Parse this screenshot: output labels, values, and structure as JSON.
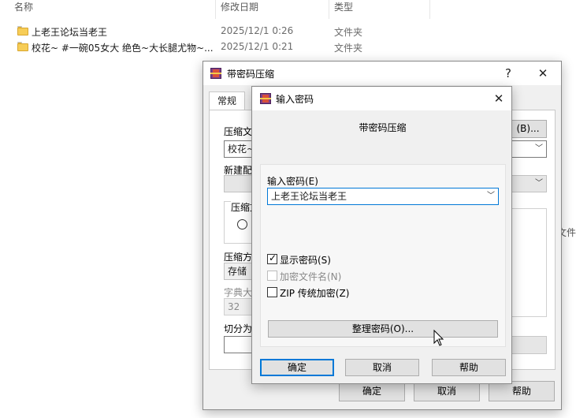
{
  "explorer": {
    "columns": {
      "name": "名称",
      "date": "修改日期",
      "type": "类型"
    },
    "rows": [
      {
        "name": "上老王论坛当老王",
        "date": "2025/12/1 0:26",
        "type": "文件夹"
      },
      {
        "name": "校花~ #一碗05女大 绝色~大长腿尤物~...",
        "date": "2025/12/1 0:21",
        "type": "文件夹"
      }
    ],
    "edge_text": "文件,"
  },
  "back_dialog": {
    "title": "带密码压缩",
    "help_btn": "?",
    "close_btn": "✕",
    "tab_general": "常规",
    "archive_name_label": "压缩文",
    "archive_name_value": "校花~",
    "browse_button": "(B)...",
    "new_profile_label": "新建配",
    "compress_format_label": "压缩文",
    "compress_method_label": "压缩方",
    "compress_method_value": "存储",
    "dict_size_label": "字典大",
    "dict_size_value": "32",
    "split_label": "切分为",
    "ok": "确定",
    "cancel": "取消",
    "help": "帮助"
  },
  "password_dialog": {
    "title": "输入密码",
    "close_btn": "✕",
    "subtitle": "带密码压缩",
    "password_label": "输入密码(E)",
    "password_value": "上老王论坛当老王",
    "show_password": {
      "label": "显示密码(S)",
      "checked": true,
      "enabled": true
    },
    "encrypt_filenames": {
      "label": "加密文件名(N)",
      "checked": false,
      "enabled": false
    },
    "zip_legacy": {
      "label": "ZIP 传统加密(Z)",
      "checked": false,
      "enabled": true
    },
    "organize_button": "整理密码(O)...",
    "ok": "确定",
    "cancel": "取消",
    "help": "帮助"
  }
}
